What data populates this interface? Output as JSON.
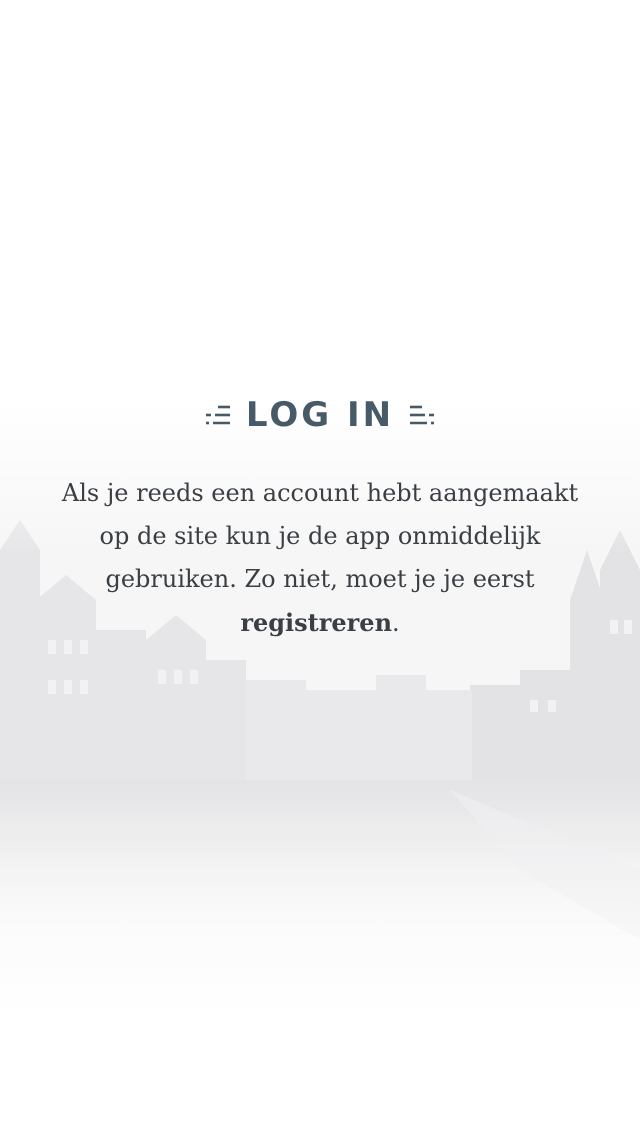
{
  "login": {
    "title": "LOG IN",
    "intro_text": "Als je reeds een account hebt aangemaakt op de site kun je de app onmiddelijk gebruiken. Zo niet, moet je je eerst",
    "register_link": "registreren",
    "intro_end": "."
  },
  "colors": {
    "title": "#465a68",
    "text": "#3a3f44",
    "background": "#ffffff"
  },
  "icons": [
    "left-lines-decoration-icon",
    "right-lines-decoration-icon"
  ]
}
